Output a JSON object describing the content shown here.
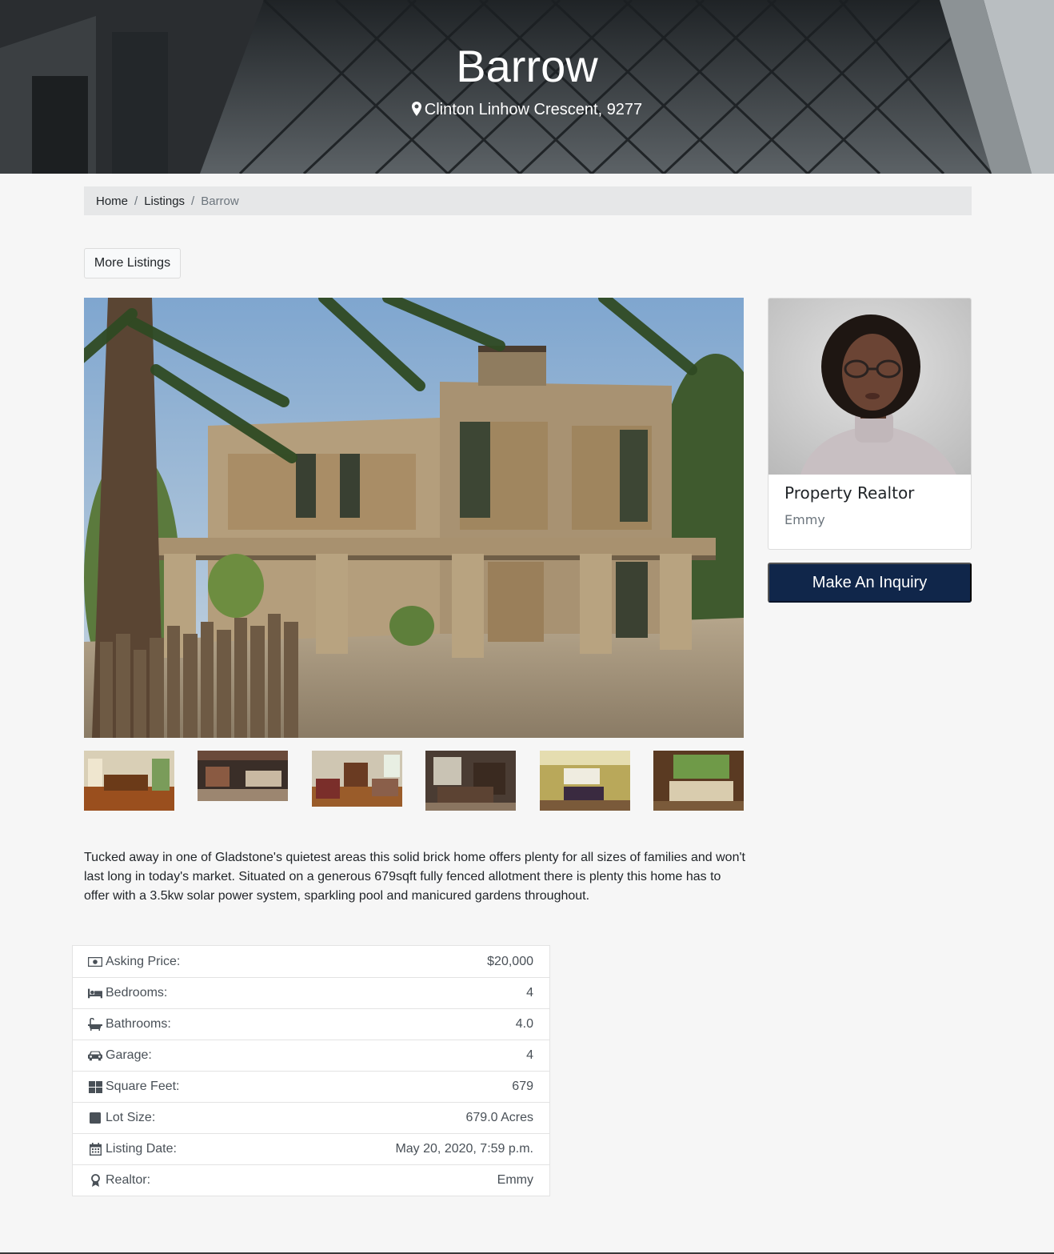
{
  "hero": {
    "title": "Barrow",
    "address": "Clinton Linhow Crescent, 9277"
  },
  "breadcrumb": {
    "home": "Home",
    "listings": "Listings",
    "current": "Barrow",
    "separator": "/"
  },
  "actions": {
    "more_listings": "More Listings",
    "make_inquiry": "Make An Inquiry"
  },
  "listing": {
    "description": "Tucked away in one of Gladstone's quietest areas this solid brick home offers plenty for all sizes of families and won't last long in today's market. Situated on a generous 679sqft fully fenced allotment there is plenty this home has to offer with a 3.5kw solar power system, sparkling pool and manicured gardens throughout.",
    "thumbnails": [
      "kitchen-dining",
      "living-room-dark",
      "living-room-fireplace",
      "dining-room",
      "billiard-room",
      "sunroom-sofa"
    ]
  },
  "details": [
    {
      "icon": "money-icon",
      "label": "Asking Price:",
      "value": "$20,000"
    },
    {
      "icon": "bed-icon",
      "label": "Bedrooms:",
      "value": "4"
    },
    {
      "icon": "bath-icon",
      "label": "Bathrooms:",
      "value": "4.0"
    },
    {
      "icon": "car-icon",
      "label": "Garage:",
      "value": "4"
    },
    {
      "icon": "grid-icon",
      "label": "Square Feet:",
      "value": "679"
    },
    {
      "icon": "square-icon",
      "label": "Lot Size:",
      "value": "679.0 Acres"
    },
    {
      "icon": "calendar-icon",
      "label": "Listing Date:",
      "value": "May 20, 2020, 7:59 p.m."
    },
    {
      "icon": "award-icon",
      "label": "Realtor:",
      "value": "Emmy"
    }
  ],
  "realtor": {
    "title": "Property Realtor",
    "name": "Emmy"
  },
  "colors": {
    "accent": "#10264a",
    "breadcrumb_bg": "#e6e7e8",
    "page_bg": "#f6f6f6"
  }
}
